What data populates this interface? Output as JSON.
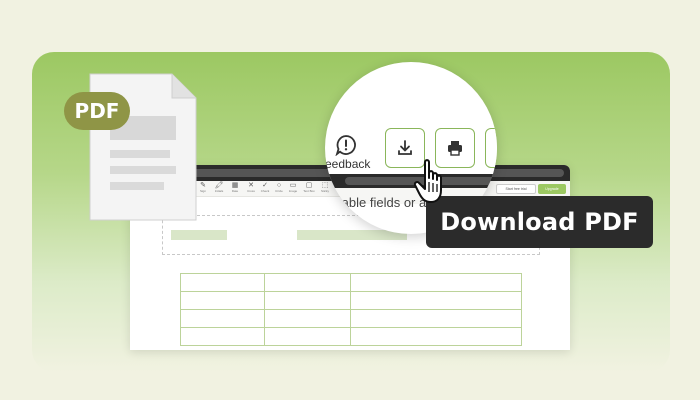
{
  "badge": {
    "label": "PDF"
  },
  "magnifier": {
    "feedback_label": "eedback",
    "subtext": "illable fields or annotatio"
  },
  "toolbar": {
    "tools": [
      {
        "icon": "T",
        "label": "Text"
      },
      {
        "icon": "✎",
        "label": "Sign"
      },
      {
        "icon": "🖍",
        "label": "Initials"
      },
      {
        "icon": "▦",
        "label": "Date"
      },
      {
        "icon": "✕",
        "label": "Cross"
      },
      {
        "icon": "✓",
        "label": "Check"
      },
      {
        "icon": "○",
        "label": "Circle"
      },
      {
        "icon": "▭",
        "label": "Image"
      },
      {
        "icon": "▢",
        "label": "Text Box"
      },
      {
        "icon": "⬚",
        "label": "Sticky"
      }
    ],
    "free_trial_label": "Start free trial",
    "upgrade_label": "Upgrade"
  },
  "tooltip": {
    "text": "Download PDF"
  },
  "colors": {
    "accent": "#9cc862",
    "badge": "#8f9546",
    "tooltip_bg": "#2b2b2b",
    "page_bg": "#f1f2e1"
  }
}
